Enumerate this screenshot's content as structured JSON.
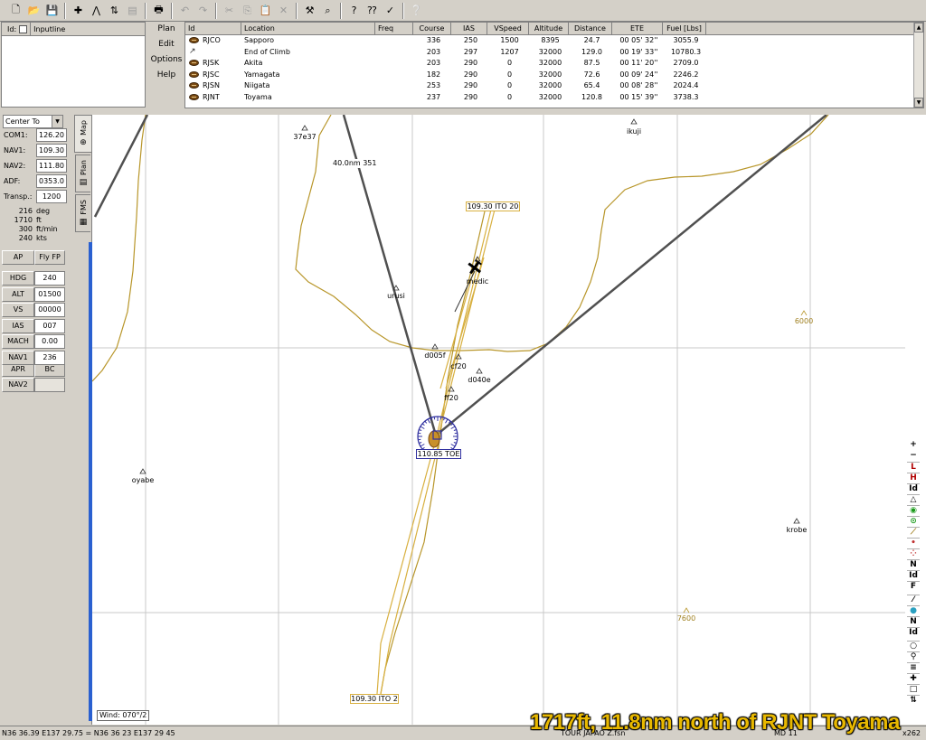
{
  "toolbar": {
    "buttons": [
      {
        "icon": "new-file-icon",
        "glyph": "🗋"
      },
      {
        "icon": "open-folder-icon",
        "glyph": "📂"
      },
      {
        "icon": "save-icon",
        "glyph": "💾"
      },
      {
        "icon": "add-waypoint-icon",
        "glyph": "✚"
      },
      {
        "icon": "route-icon",
        "glyph": "⋀"
      },
      {
        "icon": "insert-icon",
        "glyph": "⇅"
      },
      {
        "icon": "delete-icon",
        "glyph": "▤"
      },
      {
        "icon": "print-icon",
        "glyph": "🖶"
      },
      {
        "icon": "undo-icon",
        "glyph": "↶"
      },
      {
        "icon": "redo-icon",
        "glyph": "↷"
      },
      {
        "icon": "cut-icon",
        "glyph": "✂"
      },
      {
        "icon": "copy-icon",
        "glyph": "⎘"
      },
      {
        "icon": "paste-icon",
        "glyph": "📋"
      },
      {
        "icon": "clear-icon",
        "glyph": "✕"
      },
      {
        "icon": "tools-icon",
        "glyph": "⚒"
      },
      {
        "icon": "find-icon",
        "glyph": "⌕"
      },
      {
        "icon": "help-topics-icon",
        "glyph": "?"
      },
      {
        "icon": "whats-this-icon",
        "glyph": "⁇"
      },
      {
        "icon": "check-icon",
        "glyph": "✓"
      },
      {
        "icon": "about-icon",
        "glyph": "❔"
      }
    ]
  },
  "ident_panel": {
    "id_label": "Id:",
    "input_label": "Inputline"
  },
  "plan_menu": [
    "Plan",
    "Edit",
    "Options",
    "Help"
  ],
  "flight_plan": {
    "columns": [
      "Id",
      "Location",
      "Freq",
      "Course",
      "IAS",
      "VSpeed",
      "Altitude",
      "Distance",
      "ETE",
      "Fuel [Lbs]"
    ],
    "rows": [
      {
        "icon": "airport",
        "id": "RJCO",
        "location": "Sapporo",
        "freq": "",
        "course": "336",
        "ias": "250",
        "vspeed": "1500",
        "altitude": "8395",
        "distance": "24.7",
        "ete": "00 05' 32''",
        "fuel": "3055.9"
      },
      {
        "icon": "climb",
        "id": "",
        "location": "End of Climb",
        "freq": "",
        "course": "203",
        "ias": "297",
        "vspeed": "1207",
        "altitude": "32000",
        "distance": "129.0",
        "ete": "00 19' 33''",
        "fuel": "10780.3"
      },
      {
        "icon": "airport",
        "id": "RJSK",
        "location": "Akita",
        "freq": "",
        "course": "203",
        "ias": "290",
        "vspeed": "0",
        "altitude": "32000",
        "distance": "87.5",
        "ete": "00 11' 20''",
        "fuel": "2709.0"
      },
      {
        "icon": "airport",
        "id": "RJSC",
        "location": "Yamagata",
        "freq": "",
        "course": "182",
        "ias": "290",
        "vspeed": "0",
        "altitude": "32000",
        "distance": "72.6",
        "ete": "00 09' 24''",
        "fuel": "2246.2"
      },
      {
        "icon": "airport",
        "id": "RJSN",
        "location": "Niigata",
        "freq": "",
        "course": "253",
        "ias": "290",
        "vspeed": "0",
        "altitude": "32000",
        "distance": "65.4",
        "ete": "00 08' 28''",
        "fuel": "2024.4"
      },
      {
        "icon": "airport",
        "id": "RJNT",
        "location": "Toyama",
        "freq": "",
        "course": "237",
        "ias": "290",
        "vspeed": "0",
        "altitude": "32000",
        "distance": "120.8",
        "ete": "00 15' 39''",
        "fuel": "3738.3"
      }
    ]
  },
  "left_panel": {
    "center_select": "Center To",
    "radios": [
      {
        "label": "COM1:",
        "value": "126.20"
      },
      {
        "label": "NAV1:",
        "value": "109.30"
      },
      {
        "label": "NAV2:",
        "value": "111.80"
      },
      {
        "label": "ADF:",
        "value": "0353.0"
      },
      {
        "label": "Transp.:",
        "value": "1200"
      }
    ],
    "info": [
      {
        "value": "216",
        "unit": "deg"
      },
      {
        "value": "1710",
        "unit": "ft"
      },
      {
        "value": "300",
        "unit": "ft/min"
      },
      {
        "value": "240",
        "unit": "kts"
      }
    ],
    "ap_label": "AP",
    "fly_fp_label": "Fly FP",
    "autopilot": [
      {
        "label": "HDG",
        "value": "240"
      },
      {
        "label": "ALT",
        "value": "01500"
      },
      {
        "label": "VS",
        "value": "00000"
      },
      {
        "label": "IAS",
        "value": "007"
      },
      {
        "label": "MACH",
        "value": "0.00"
      },
      {
        "label": "NAV1",
        "value": "236"
      }
    ],
    "apr_label": "APR",
    "bc_label": "BC",
    "nav2_label": "NAV2"
  },
  "tabs": [
    {
      "label": "Map",
      "icon": "globe-icon",
      "glyph": "⊕"
    },
    {
      "label": "Plan",
      "icon": "table-icon",
      "glyph": "▤"
    },
    {
      "label": "FMS",
      "icon": "calc-icon",
      "glyph": "▦"
    }
  ],
  "map": {
    "waypoints": [
      {
        "name": "37e37"
      },
      {
        "name": "ikuji"
      },
      {
        "name": "urusi"
      },
      {
        "name": "medic"
      },
      {
        "name": "d005f"
      },
      {
        "name": "cf20"
      },
      {
        "name": "d040e"
      },
      {
        "name": "ff20"
      },
      {
        "name": "oyabe"
      },
      {
        "name": "krobe"
      }
    ],
    "elevations": [
      "6000",
      "7600"
    ],
    "leg_label": "40.0nm 351",
    "ils_top_label": "109.30 ITO 20",
    "ils_bottom_label": "109.30 ITO 2",
    "vor_label": "110.85 TOE",
    "wind": "Wind: 070°/2"
  },
  "tools": [
    {
      "icon": "zoom-in-icon",
      "glyph": "+"
    },
    {
      "icon": "zoom-out-icon",
      "glyph": "−"
    },
    {
      "icon": "low-airways-icon",
      "glyph": "L"
    },
    {
      "icon": "high-airways-icon",
      "glyph": "H"
    },
    {
      "icon": "ids-icon",
      "glyph": "Id"
    },
    {
      "icon": "triangle-icon",
      "glyph": "△"
    },
    {
      "icon": "vor-icon",
      "glyph": "◉"
    },
    {
      "icon": "ndb-icon",
      "glyph": "⊙"
    },
    {
      "icon": "ils-icon",
      "glyph": "⟋"
    },
    {
      "icon": "dot-icon",
      "glyph": "•"
    },
    {
      "icon": "dots-icon",
      "glyph": "⁘"
    },
    {
      "icon": "n-label-icon",
      "glyph": "N"
    },
    {
      "icon": "id-label-icon",
      "glyph": "Id"
    },
    {
      "icon": "freq-icon",
      "glyph": "F"
    },
    {
      "icon": "sep-icon",
      "glyph": ""
    },
    {
      "icon": "runway-icon",
      "glyph": "⁄"
    },
    {
      "icon": "airport-dot-icon",
      "glyph": "●"
    },
    {
      "icon": "n2-label-icon",
      "glyph": "N"
    },
    {
      "icon": "id2-label-icon",
      "glyph": "Id"
    },
    {
      "icon": "sep2-icon",
      "glyph": ""
    },
    {
      "icon": "circle-icon",
      "glyph": "○"
    },
    {
      "icon": "search-icon",
      "glyph": "⚲"
    },
    {
      "icon": "list-icon",
      "glyph": "≡"
    },
    {
      "icon": "plus-cross-icon",
      "glyph": "✚"
    },
    {
      "icon": "square-icon",
      "glyph": "□"
    },
    {
      "icon": "swap-icon",
      "glyph": "⇅"
    }
  ],
  "status": {
    "coords": "N36 36.39   E137 29.75  =  N36 36 23    E137 29 45",
    "file": "TOUR JAPAO Z.fsn",
    "mode": "MD 11",
    "zoom": "x262"
  },
  "caption": "1717ft, 11.8nm north of RJNT Toyama",
  "colors": {
    "terrain": "#b8962a",
    "route": "#505050",
    "ils": "#d8b040",
    "vor": "#3030a0",
    "caption": "#e8b800"
  }
}
